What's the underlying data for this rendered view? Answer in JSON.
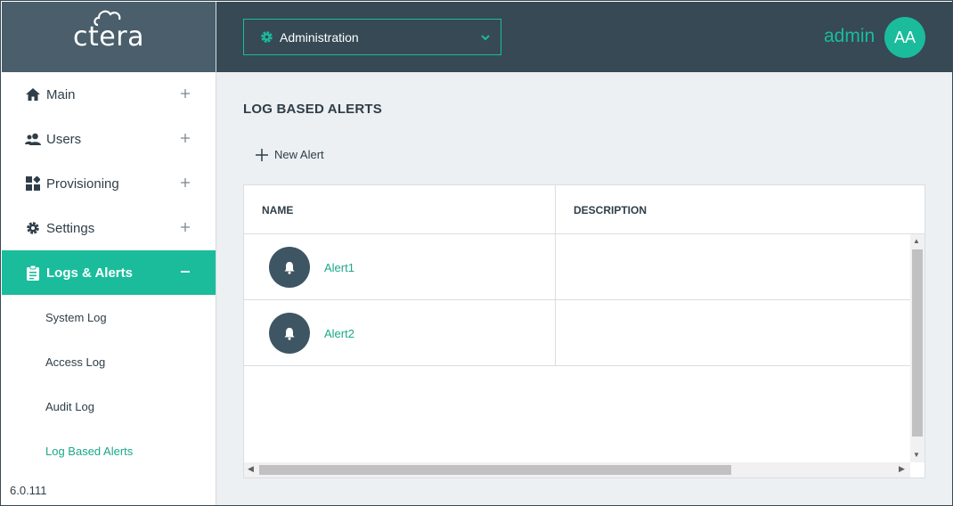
{
  "app": {
    "logo_text": "ctera",
    "version": "6.0.111"
  },
  "sidebar": {
    "items": [
      {
        "label": "Main",
        "icon": "home-icon",
        "expanded": false
      },
      {
        "label": "Users",
        "icon": "users-icon",
        "expanded": false
      },
      {
        "label": "Provisioning",
        "icon": "provisioning-icon",
        "expanded": false
      },
      {
        "label": "Settings",
        "icon": "gear-icon",
        "expanded": false
      },
      {
        "label": "Logs & Alerts",
        "icon": "clipboard-icon",
        "expanded": true
      }
    ],
    "sub_items": [
      {
        "label": "System Log"
      },
      {
        "label": "Access Log"
      },
      {
        "label": "Audit Log"
      },
      {
        "label": "Log Based Alerts",
        "selected": true
      }
    ]
  },
  "header": {
    "context_select": "Administration",
    "user_name": "admin",
    "avatar_initials": "AA"
  },
  "main": {
    "title": "LOG BASED ALERTS",
    "new_alert_label": "New Alert",
    "columns": [
      "NAME",
      "DESCRIPTION"
    ],
    "rows": [
      {
        "name": "Alert1",
        "description": ""
      },
      {
        "name": "Alert2",
        "description": ""
      }
    ]
  },
  "colors": {
    "accent": "#1abc9c",
    "header_bg": "#364955",
    "logo_bg": "#4a5e6b",
    "main_bg": "#ecf0f3",
    "text": "#2f3e48"
  }
}
